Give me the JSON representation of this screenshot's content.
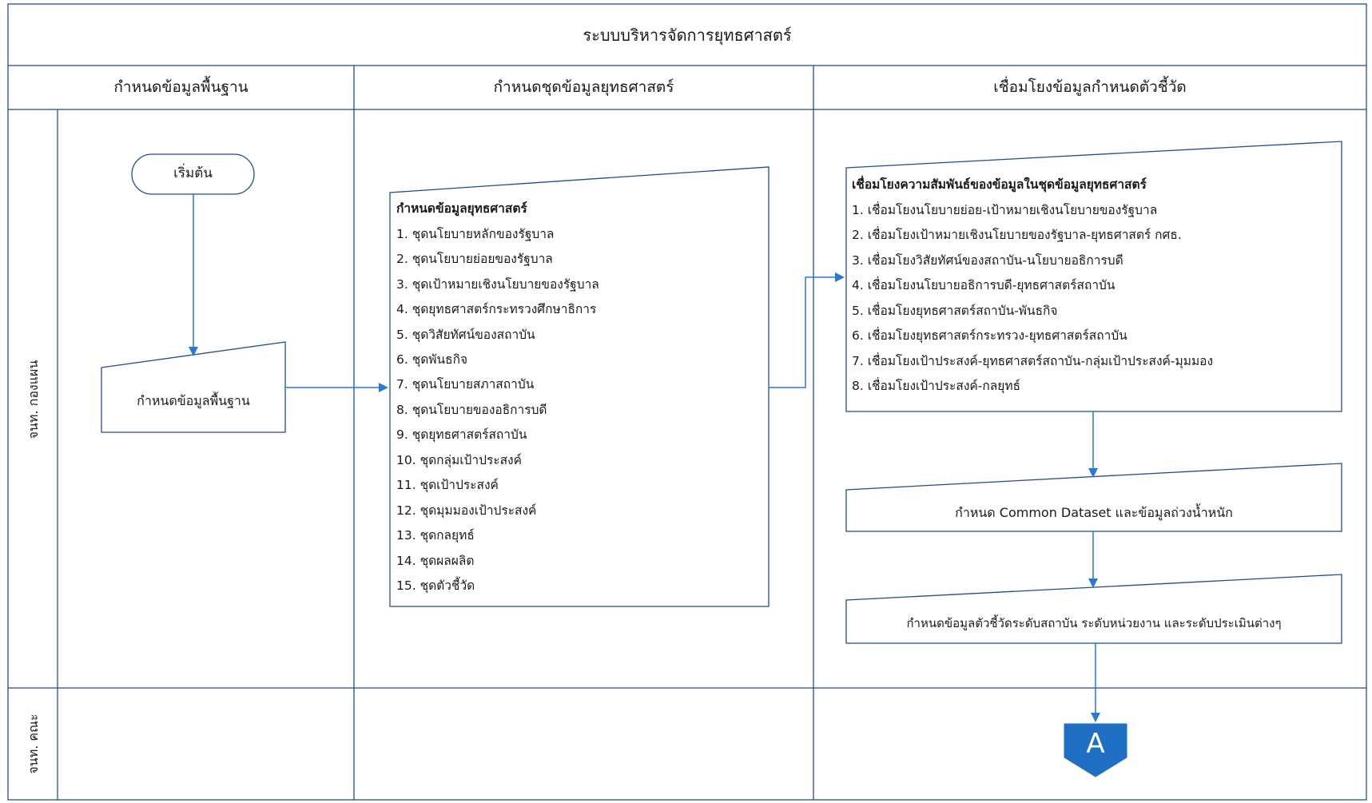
{
  "title": "ระบบบริหารจัดการยุทธศาสตร์",
  "columns": [
    "กำหนดข้อมูลพื้นฐาน",
    "กำหนดชุดข้อมูลยุทธศาสตร์",
    "เชื่อมโยงข้อมูลกำหนดตัวชี้วัด"
  ],
  "lanes": [
    "จนท. กองแผน",
    "จนท. คณะ"
  ],
  "start_label": "เริ่มต้น",
  "basic_data_label": "กำหนดข้อมูลพื้นฐาน",
  "strategy_sets": {
    "heading": "กำหนดข้อมูลยุทธศาสตร์",
    "items": [
      "1. ชุดนโยบายหลักของรัฐบาล",
      "2. ชุดนโยบายย่อยของรัฐบาล",
      "3. ชุดเป้าหมายเชิงนโยบายของรัฐบาล",
      "4. ชุดยุทธศาสตร์กระทรวงศึกษาธิการ",
      "5. ชุดวิสัยทัศน์ของสถาบัน",
      "6. ชุดพันธกิจ",
      "7. ชุดนโยบายสภาสถาบัน",
      "8. ชุดนโยบายของอธิการบดี",
      "9. ชุดยุทธศาสตร์สถาบัน",
      "10. ชุดกลุ่มเป้าประสงค์",
      "11. ชุดเป้าประสงค์",
      "12. ชุดมุมมองเป้าประสงค์",
      "13. ชุดกลยุทธ์",
      "14. ชุดผลผลิต",
      "15. ชุดตัวชี้วัด"
    ]
  },
  "relations": {
    "heading": "เชื่อมโยงความสัมพันธ์ของข้อมูลในชุดข้อมูลยุทธศาสตร์",
    "items": [
      "1. เชื่อมโยงนโยบายย่อย-เป้าหมายเชิงนโยบายของรัฐบาล",
      "2. เชื่อมโยงเป้าหมายเชิงนโยบายของรัฐบาล-ยุทธศาสตร์ กศธ.",
      "3. เชื่อมโยงวิสัยทัศน์ของสถาบัน-นโยบายอธิการบดี",
      "4. เชื่อมโยงนโยบายอธิการบดี-ยุทธศาสตร์สถาบัน",
      "5. เชื่อมโยงยุทธศาสตร์สถาบัน-พันธกิจ",
      "6. เชื่อมโยงยุทธศาสตร์กระทรวง-ยุทธศาสตร์สถาบัน",
      "7. เชื่อมโยงเป้าประสงค์-ยุทธศาสตร์สถาบัน-กลุ่มเป้าประสงค์-มุมมอง",
      "8. เชื่อมโยงเป้าประสงค์-กลยุทธ์"
    ]
  },
  "common_dataset_label": "กำหนด Common Dataset และข้อมูลถ่วงน้ำหนัก",
  "indicator_label": "กำหนดข้อมูลตัวชี้วัดระดับสถาบัน ระดับหน่วยงาน และระดับประเมินต่างๆ",
  "connector_label": "A",
  "colors": {
    "line": "#1f6fc5",
    "border": "#1f4e8c",
    "connector": "#1f6fc5"
  }
}
